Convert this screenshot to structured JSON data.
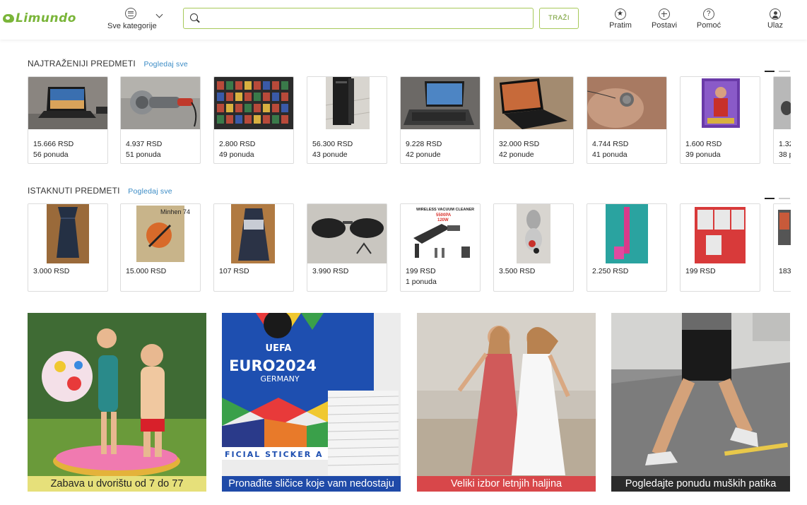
{
  "header": {
    "logo_text": "Limundo",
    "categories_label": "Sve kategorije",
    "search_placeholder": "",
    "search_button": "TRAŽI",
    "nav": [
      {
        "label": "Pratim",
        "icon": "star-icon"
      },
      {
        "label": "Postavi",
        "icon": "plus-icon"
      },
      {
        "label": "Pomoć",
        "icon": "help-icon"
      },
      {
        "label": "Ulaz",
        "icon": "user-icon"
      }
    ]
  },
  "most_wanted": {
    "title": "NAJTRAŽENIJI PREDMETI",
    "link": "Pogledaj sve",
    "items": [
      {
        "price": "15.666 RSD",
        "offers": "56 ponuda",
        "image": "laptop-photo"
      },
      {
        "price": "4.937 RSD",
        "offers": "51 ponuda",
        "image": "angle-grinder-photo"
      },
      {
        "price": "2.800 RSD",
        "offers": "49 ponuda",
        "image": "sticker-album-photo"
      },
      {
        "price": "56.300 RSD",
        "offers": "43 ponude",
        "image": "pc-tower-photo"
      },
      {
        "price": "9.228 RSD",
        "offers": "42 ponude",
        "image": "laptop-photo"
      },
      {
        "price": "32.000 RSD",
        "offers": "42 ponude",
        "image": "laptop-photo"
      },
      {
        "price": "4.744 RSD",
        "offers": "41 ponuda",
        "image": "coin-photo"
      },
      {
        "price": "1.600 RSD",
        "offers": "39 ponuda",
        "image": "football-card-photo"
      },
      {
        "price": "1.32",
        "offers": "38 p",
        "image": "partial-item-photo"
      }
    ]
  },
  "featured": {
    "title": "ISTAKNUTI PREDMETI",
    "link": "Pogledaj sve",
    "items": [
      {
        "price": "3.000 RSD",
        "offers": "",
        "image": "dress-photo"
      },
      {
        "price": "15.000 RSD",
        "offers": "",
        "image": "poster-photo"
      },
      {
        "price": "107 RSD",
        "offers": "",
        "image": "dress-photo"
      },
      {
        "price": "3.990 RSD",
        "offers": "",
        "image": "sunglasses-photo"
      },
      {
        "price": "199 RSD",
        "offers": "1 ponuda",
        "image": "vacuum-cleaner-photo"
      },
      {
        "price": "3.500 RSD",
        "offers": "",
        "image": "brooch-photo"
      },
      {
        "price": "2.250 RSD",
        "offers": "",
        "image": "cosmetic-pen-photo"
      },
      {
        "price": "199 RSD",
        "offers": "",
        "image": "jewelry-box-photo"
      },
      {
        "price": "183",
        "offers": "",
        "image": "partial-item-photo"
      }
    ],
    "vacuum_text": {
      "line1": "WIRELESS VACUUM CLEANER",
      "line2": "5500PA",
      "line3": "120W"
    },
    "poster_text": "Minhen 74"
  },
  "banners": [
    {
      "caption": "Zabava u dvorištu od 7 do 77",
      "caption_bg": "#e6e07a",
      "caption_color": "#222222"
    },
    {
      "caption": "Pronađite sličice koje vam nedostaju",
      "caption_bg": "#1f4aa8",
      "caption_color": "#ffffff",
      "poster_line1": "UEFA",
      "poster_line2": "EURO2024",
      "poster_line3": "GERMANY",
      "strip_text": "FICIAL STICKER A"
    },
    {
      "caption": "Veliki izbor letnjih haljina",
      "caption_bg": "#d8474a",
      "caption_color": "#ffffff"
    },
    {
      "caption": "Pogledajte ponudu muških patika",
      "caption_bg": "#2b2b2b",
      "caption_color": "#ffffff"
    }
  ],
  "colors": {
    "brand_green": "#7ab539",
    "link_blue": "#3a8bc5",
    "search_border": "#a7c95a"
  }
}
